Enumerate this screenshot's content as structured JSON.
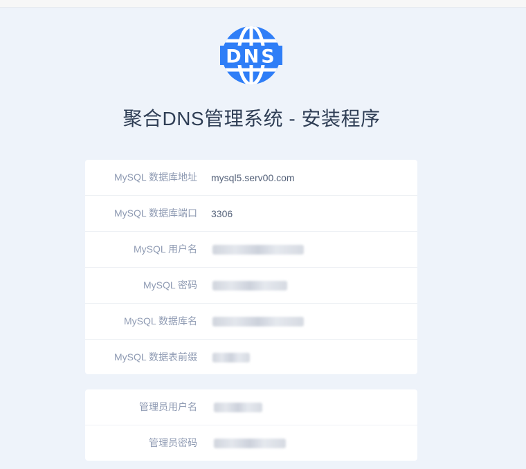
{
  "app": {
    "title": "聚合DNS管理系统 - 安装程序",
    "logo_text": "DNS",
    "logo_icon": "globe-icon",
    "accent_color": "#2f7ef7"
  },
  "database_form": {
    "fields": [
      {
        "label": "MySQL 数据库地址",
        "value": "mysql5.serv00.com"
      },
      {
        "label": "MySQL 数据库端口",
        "value": "3306"
      },
      {
        "label": "MySQL 用户名",
        "value": "",
        "redacted": true
      },
      {
        "label": "MySQL 密码",
        "value": "",
        "redacted": true
      },
      {
        "label": "MySQL 数据库名",
        "value": "",
        "redacted": true
      },
      {
        "label": "MySQL 数据表前缀",
        "value": "",
        "redacted": true
      }
    ]
  },
  "admin_form": {
    "fields": [
      {
        "label": "管理员用户名",
        "value": "",
        "redacted": true
      },
      {
        "label": "管理员密码",
        "value": "",
        "redacted": true
      }
    ]
  }
}
